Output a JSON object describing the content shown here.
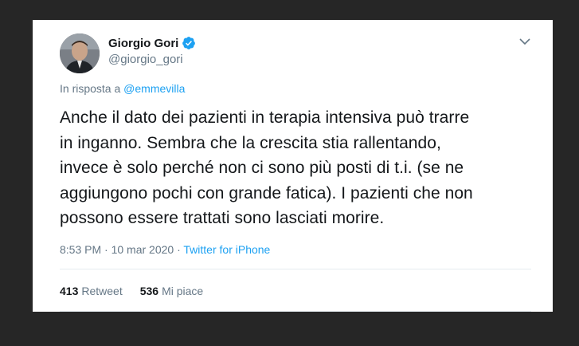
{
  "tweet": {
    "display_name": "Giorgio Gori",
    "handle": "@giorgio_gori",
    "reply_prefix": "In risposta a",
    "reply_to": "@emmevilla",
    "text_lines": [
      "Anche il dato dei pazienti in terapia intensiva può trarre",
      "in inganno. Sembra che la crescita stia rallentando,",
      "invece è solo perché non ci sono più posti di t.i. (se ne",
      "aggiungono pochi con grande fatica). I pazienti che non",
      "possono essere trattati sono lasciati morire."
    ],
    "time": "8:53 PM",
    "date": "10 mar 2020",
    "separator": "·",
    "source": "Twitter for iPhone",
    "retweets_count": "413",
    "retweets_label": "Retweet",
    "likes_count": "536",
    "likes_label": "Mi piace"
  },
  "colors": {
    "accent": "#1da1f2",
    "secondary_text": "#657786",
    "primary_text": "#14171a",
    "frame": "#262626"
  },
  "icons": {
    "verified": "verified-badge-icon",
    "caret": "chevron-down-icon"
  }
}
